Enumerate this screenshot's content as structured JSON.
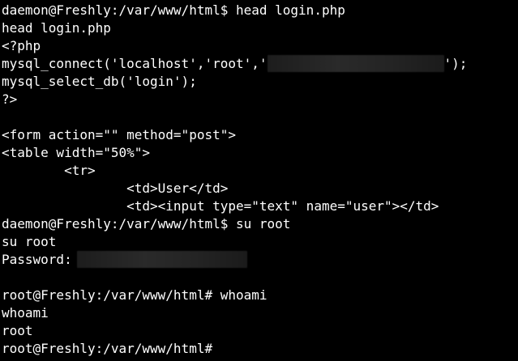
{
  "terminal": {
    "lines": [
      "daemon@Freshly:/var/www/html$ head login.php",
      "head login.php",
      "<?php",
      "mysql_connect('localhost','root','",
      "mysql_select_db('login');",
      "?>",
      "",
      "<form action=\"\" method=\"post\">",
      "<table width=\"50%\">",
      "        <tr>",
      "                <td>User</td>",
      "                <td><input type=\"text\" name=\"user\"></td>",
      "daemon@Freshly:/var/www/html$ su root",
      "su root",
      "Password:",
      "",
      "root@Freshly:/var/www/html# whoami",
      "whoami",
      "root",
      "root@Freshly:/var/www/html#"
    ],
    "mysql_connect_suffix": "');",
    "colors": {
      "background": "#000000",
      "foreground": "#ffffff",
      "redaction": "#242424"
    }
  }
}
